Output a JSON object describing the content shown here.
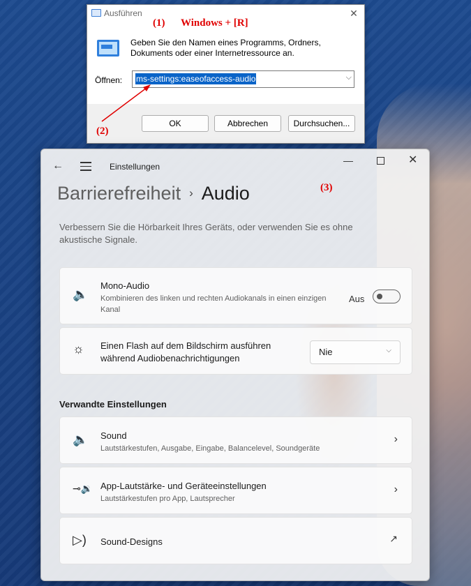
{
  "run_dialog": {
    "title": "Ausführen",
    "description": "Geben Sie den Namen eines Programms, Ordners, Dokuments oder einer Internetressource an.",
    "open_label": "Öffnen:",
    "input_value": "ms-settings:easeofaccess-audio",
    "buttons": {
      "ok": "OK",
      "cancel": "Abbrechen",
      "browse": "Durchsuchen..."
    }
  },
  "annotations": {
    "step1": "(1)",
    "shortcut": "Windows + [R]",
    "step2": "(2)",
    "step3": "(3)"
  },
  "settings": {
    "app_title": "Einstellungen",
    "breadcrumb_parent": "Barrierefreiheit",
    "breadcrumb_separator": "›",
    "breadcrumb_current": "Audio",
    "intro": "Verbessern Sie die Hörbarkeit Ihres Geräts, oder verwenden Sie es ohne akustische Signale.",
    "mono": {
      "title": "Mono-Audio",
      "description": "Kombinieren des linken und rechten Audiokanals in einen einzigen Kanal",
      "toggle_label": "Aus",
      "toggle_on": false
    },
    "flash": {
      "title": "Einen Flash auf dem Bildschirm ausführen während Audiobenachrichtigungen",
      "selected": "Nie"
    },
    "related_heading": "Verwandte Einstellungen",
    "related": [
      {
        "title": "Sound",
        "description": "Lautstärkestufen, Ausgabe, Eingabe, Balancelevel, Soundgeräte"
      },
      {
        "title": "App-Lautstärke- und Geräteeinstellungen",
        "description": "Lautstärkestufen pro App, Lautsprecher"
      },
      {
        "title": "Sound-Designs",
        "description": ""
      }
    ]
  },
  "colors": {
    "annotation": "#e00000",
    "selection": "#0a64c8",
    "desktop": "#1a3f82"
  }
}
